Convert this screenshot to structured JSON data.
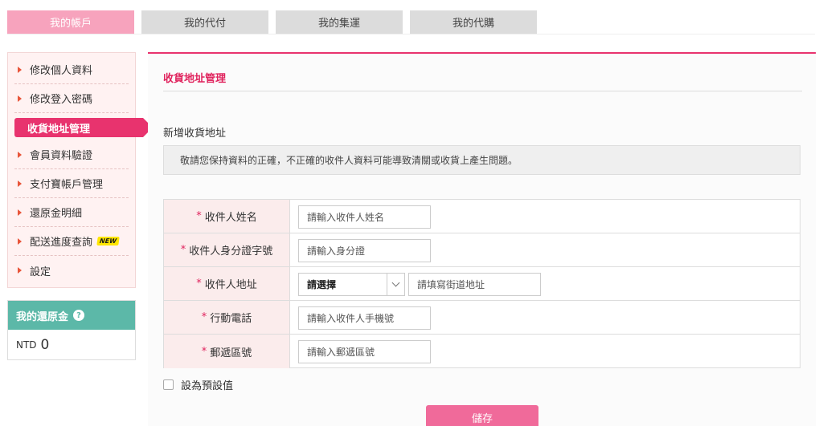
{
  "tabs": [
    {
      "label": "我的帳戶",
      "active": true
    },
    {
      "label": "我的代付",
      "active": false
    },
    {
      "label": "我的集運",
      "active": false
    },
    {
      "label": "我的代購",
      "active": false
    }
  ],
  "sidebar": {
    "items": [
      {
        "label": "修改個人資料"
      },
      {
        "label": "修改登入密碼"
      },
      {
        "label": "收貨地址管理"
      },
      {
        "label": "會員資料驗證"
      },
      {
        "label": "支付寶帳戶管理"
      },
      {
        "label": "還原金明細"
      },
      {
        "label": "配送進度查詢",
        "badge": "NEW"
      },
      {
        "label": "設定"
      }
    ]
  },
  "rebate": {
    "title": "我的還原金",
    "help_icon": "?",
    "currency": "NTD",
    "amount": "0"
  },
  "main": {
    "title": "收貨地址管理",
    "section_title": "新增收貨地址",
    "notice": "敬請您保持資料的正確，不正確的收件人資料可能導致清關或收貨上產生問題。"
  },
  "form": {
    "required_mark": "*",
    "name": {
      "label": "收件人姓名",
      "placeholder": "請輸入收件人姓名"
    },
    "id_number": {
      "label": "收件人身分證字號",
      "placeholder": "請輸入身分證"
    },
    "address": {
      "label": "收件人地址",
      "select_value": "請選擇",
      "placeholder": "請填寫街道地址"
    },
    "mobile": {
      "label": "行動電話",
      "placeholder": "請輸入收件人手機號"
    },
    "postal": {
      "label": "郵遞區號",
      "placeholder": "請輸入郵遞區號"
    },
    "default_label": "設為預設值",
    "save_label": "儲存"
  },
  "colors": {
    "accent": "#e8336e",
    "tab_active": "#f7a3bd",
    "rebate_header": "#5cb8a8",
    "save_button": "#f06a9a"
  }
}
